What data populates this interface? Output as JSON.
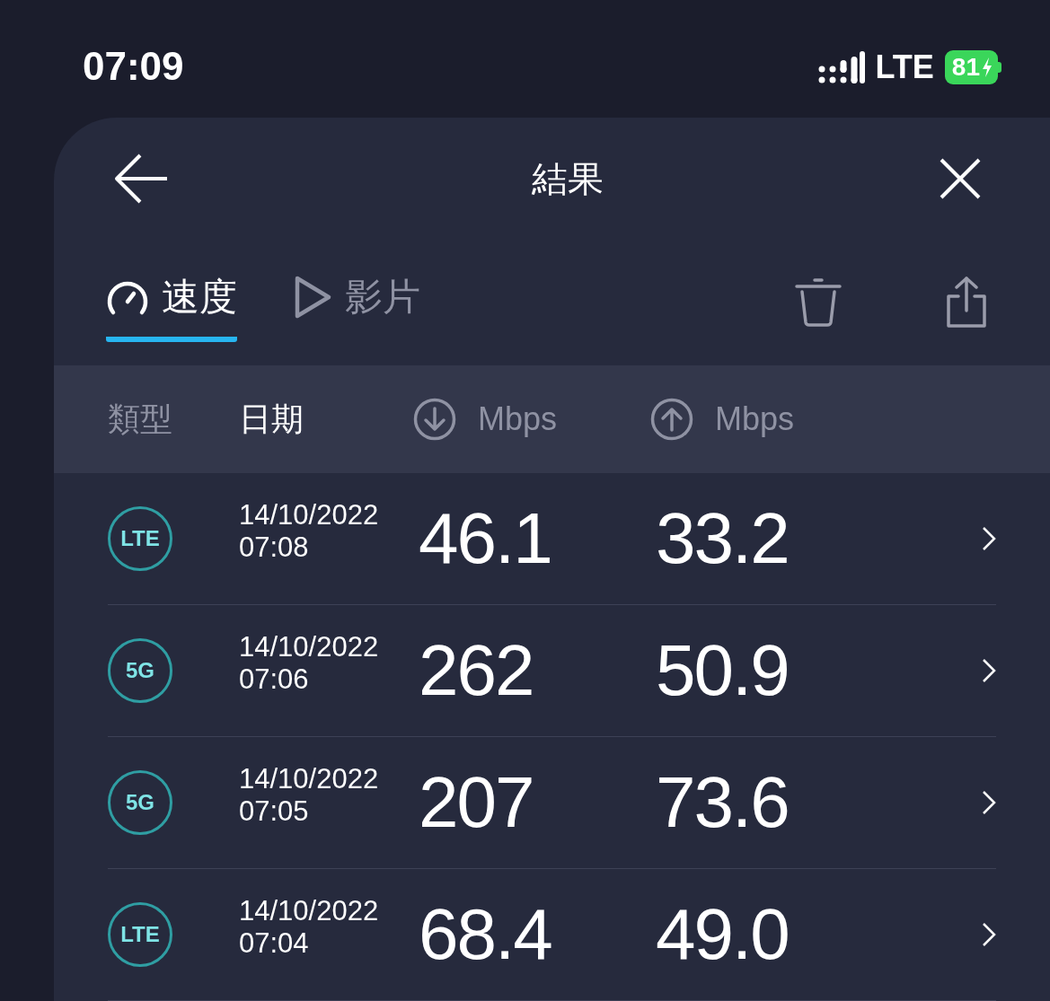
{
  "status_bar": {
    "time": "07:09",
    "network": "LTE",
    "battery": "81"
  },
  "header": {
    "title": "結果"
  },
  "tabs": [
    {
      "label": "速度",
      "kind": "speed",
      "selected": true
    },
    {
      "label": "影片",
      "kind": "video",
      "selected": false
    }
  ],
  "columns": [
    {
      "label": "類型",
      "kind": "text",
      "selected": false
    },
    {
      "label": "日期",
      "kind": "text",
      "selected": true
    },
    {
      "label": "Mbps",
      "kind": "download",
      "selected": false
    },
    {
      "label": "Mbps",
      "kind": "upload",
      "selected": false
    }
  ],
  "rows": [
    {
      "type": "LTE",
      "date": "14/10/2022",
      "time": "07:08",
      "download": "46.1",
      "upload": "33.2"
    },
    {
      "type": "5G",
      "date": "14/10/2022",
      "time": "07:06",
      "download": "262",
      "upload": "50.9"
    },
    {
      "type": "5G",
      "date": "14/10/2022",
      "time": "07:05",
      "download": "207",
      "upload": "73.6"
    },
    {
      "type": "LTE",
      "date": "14/10/2022",
      "time": "07:04",
      "download": "68.4",
      "upload": "49.0"
    }
  ]
}
